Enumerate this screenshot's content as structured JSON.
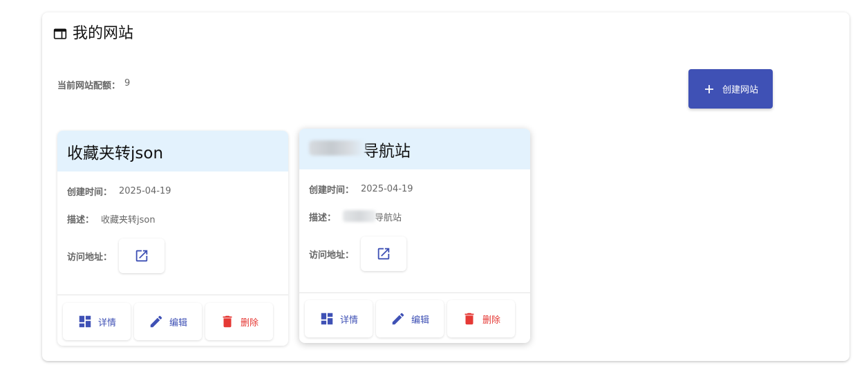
{
  "header": {
    "title": "我的网站",
    "icon": "web-window-icon"
  },
  "quota": {
    "label": "当前网站配额：",
    "value": "9"
  },
  "create_button": {
    "label": "创建网站",
    "icon": "plus-icon"
  },
  "colors": {
    "primary": "#3f51b5",
    "danger": "#e53935",
    "card_header": "#e3f2fd"
  },
  "cards": [
    {
      "title": "收藏夹转json",
      "created_label": "创建时间：",
      "created_value": "2025-04-19",
      "desc_label": "描述：",
      "desc_value": "收藏夹转json",
      "visit_label": "访问地址：",
      "actions": {
        "detail": "详情",
        "edit": "编辑",
        "delete": "删除"
      }
    },
    {
      "title": "导航站",
      "created_label": "创建时间：",
      "created_value": "2025-04-19",
      "desc_label": "描述：",
      "desc_value": "导航站",
      "visit_label": "访问地址：",
      "actions": {
        "detail": "详情",
        "edit": "编辑",
        "delete": "删除"
      }
    }
  ]
}
